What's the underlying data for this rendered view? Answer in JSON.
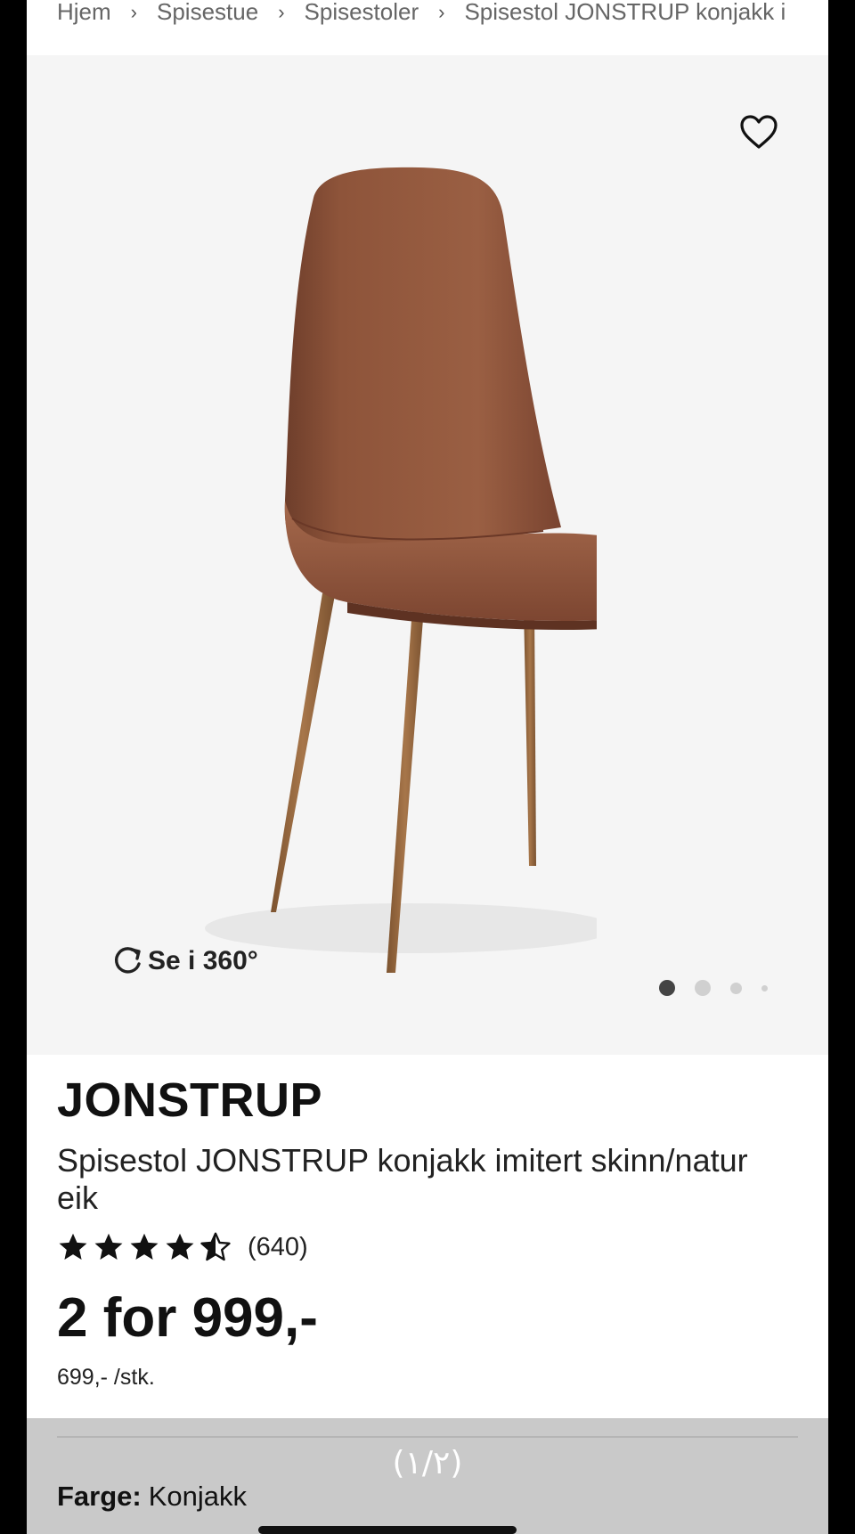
{
  "breadcrumb": {
    "items": [
      "Hjem",
      "Spisestue",
      "Spisestoler",
      "Spisestol JONSTRUP konjakk i"
    ],
    "separator": "›"
  },
  "gallery": {
    "favorite_icon": "heart-icon",
    "rotate_icon": "rotate-icon",
    "view_360_label": "Se i 360°",
    "dots_total": 4,
    "active_dot": 1
  },
  "product": {
    "brand": "JONSTRUP",
    "description": "Spisestol JONSTRUP konjakk imitert skinn/natur eik",
    "rating": 4.5,
    "rating_count": "(640)",
    "price": "2 for 999,-",
    "unit_price": "699,- /stk."
  },
  "overlay": {
    "page_indicator": "(١/٢)",
    "color_label": "Farge:",
    "color_value": "Konjakk"
  },
  "colors": {
    "gallery_bg": "#f5f5f5",
    "chair_leather": "#8b5038",
    "chair_legs": "#9a6a3e",
    "overlay_bg": "#c9c9c9"
  }
}
